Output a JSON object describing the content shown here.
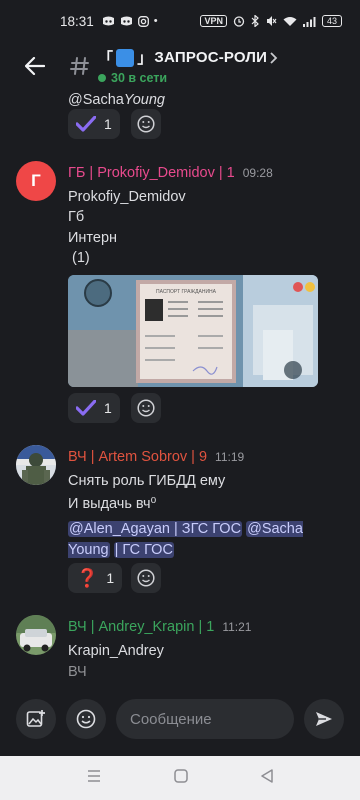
{
  "status_bar": {
    "time": "18:31",
    "vpn": "VPN",
    "battery": "43"
  },
  "header": {
    "title_prefix": "「",
    "title_mid": "」",
    "title": "ЗАПРОС-РОЛИ",
    "online": "30 в сети"
  },
  "messages": {
    "prev_mention": "@Sacha",
    "prev_mention_tail": "Young",
    "prev_reaction_count": "1",
    "msg1": {
      "avatar_letter": "Г",
      "author": "ГБ | Prokofiy_Demidov | 1",
      "author_color": "#e84a8d",
      "time": "09:28",
      "lines": [
        "Prokofiy_Demidov",
        "Гб",
        "Интерн",
        " (1)"
      ],
      "reaction_count": "1",
      "doc_title": "ПАСПОРТ ГРАЖДАНИНА"
    },
    "msg2": {
      "author": "ВЧ | Artem Sobrov | 9",
      "author_color": "#e0533f",
      "time": "11:19",
      "lines": [
        "Снять роль ГИБДД ему",
        "И выдачь вч⁰"
      ],
      "mention_1": "@Alen_Agayan | ЗГС ГОС",
      "mention_2": "@Sacha Young",
      "mention_3": "| ГС ГОС",
      "reaction_emoji": "❓",
      "reaction_count": "1"
    },
    "msg3": {
      "author": "ВЧ | Andrey_Krapin | 1",
      "author_color": "#3ba55d",
      "time": "11:21",
      "lines": [
        "Krapin_Andrey",
        "ВЧ"
      ]
    }
  },
  "composer": {
    "placeholder": "Сообщение"
  },
  "colors": {
    "background": "#1b1c20",
    "online": "#3ba55d",
    "mention_bg": "#3c4270",
    "reaction_check": "#8a6cf2"
  }
}
